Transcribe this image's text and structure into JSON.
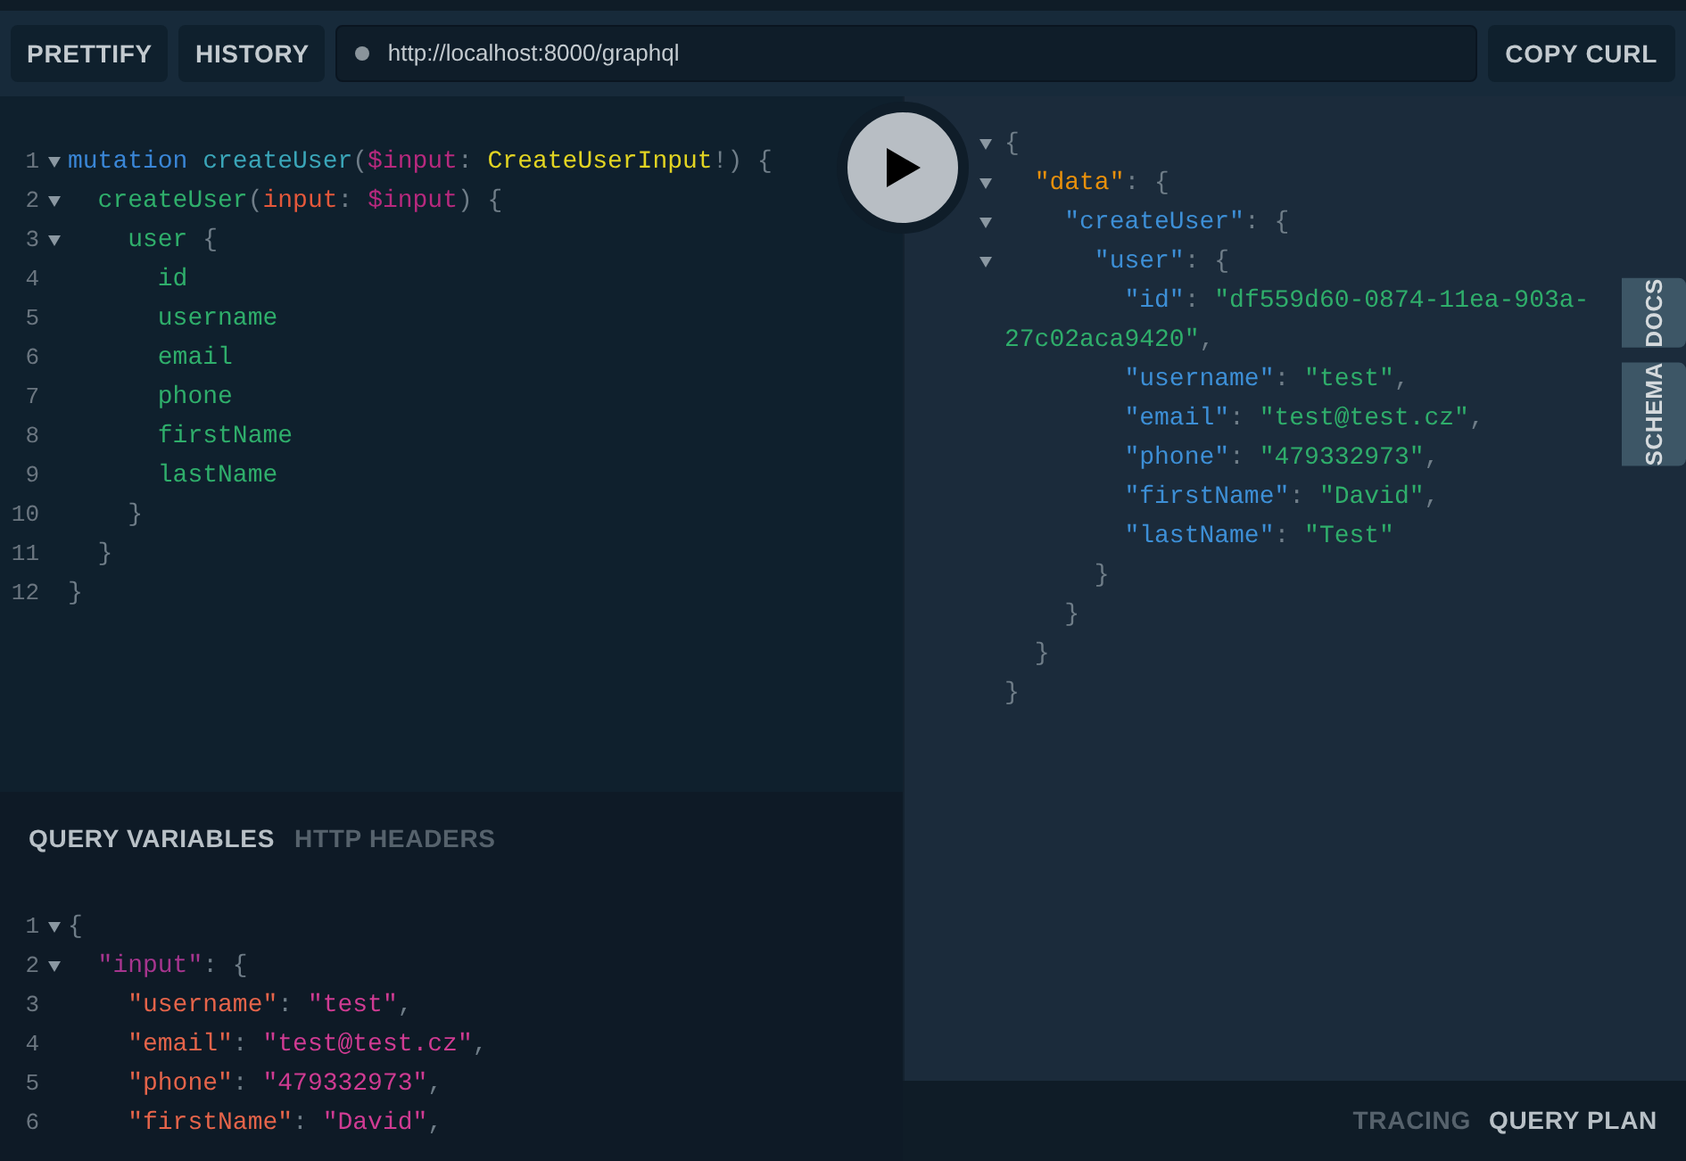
{
  "toolbar": {
    "buttons": [
      "PRETTIFY",
      "HISTORY"
    ],
    "url": "http://localhost:8000/graphql",
    "copy_button": "COPY CURL"
  },
  "query_editor": {
    "lines": [
      {
        "number": "1",
        "foldable": true,
        "tokens": [
          {
            "kind": "keyword",
            "text": "mutation "
          },
          {
            "kind": "def",
            "text": "createUser"
          },
          {
            "kind": "punct",
            "text": "("
          },
          {
            "kind": "variable",
            "text": "$input"
          },
          {
            "kind": "punct",
            "text": ": "
          },
          {
            "kind": "type",
            "text": "CreateUserInput"
          },
          {
            "kind": "punct",
            "text": "!) {"
          }
        ]
      },
      {
        "number": "2",
        "foldable": true,
        "tokens": [
          {
            "kind": "field",
            "text": "  createUser"
          },
          {
            "kind": "punct",
            "text": "("
          },
          {
            "kind": "argument",
            "text": "input"
          },
          {
            "kind": "punct",
            "text": ": "
          },
          {
            "kind": "variable",
            "text": "$input"
          },
          {
            "kind": "punct",
            "text": ") {"
          }
        ]
      },
      {
        "number": "3",
        "foldable": true,
        "tokens": [
          {
            "kind": "field",
            "text": "    user "
          },
          {
            "kind": "punct",
            "text": "{"
          }
        ]
      },
      {
        "number": "4",
        "foldable": false,
        "tokens": [
          {
            "kind": "field",
            "text": "      id"
          }
        ]
      },
      {
        "number": "5",
        "foldable": false,
        "tokens": [
          {
            "kind": "field",
            "text": "      username"
          }
        ]
      },
      {
        "number": "6",
        "foldable": false,
        "tokens": [
          {
            "kind": "field",
            "text": "      email"
          }
        ]
      },
      {
        "number": "7",
        "foldable": false,
        "tokens": [
          {
            "kind": "field",
            "text": "      phone"
          }
        ]
      },
      {
        "number": "8",
        "foldable": false,
        "tokens": [
          {
            "kind": "field",
            "text": "      firstName"
          }
        ]
      },
      {
        "number": "9",
        "foldable": false,
        "tokens": [
          {
            "kind": "field",
            "text": "      lastName"
          }
        ]
      },
      {
        "number": "10",
        "foldable": false,
        "tokens": [
          {
            "kind": "punct",
            "text": "    }"
          }
        ]
      },
      {
        "number": "11",
        "foldable": false,
        "tokens": [
          {
            "kind": "punct",
            "text": "  }"
          }
        ]
      },
      {
        "number": "12",
        "foldable": false,
        "tokens": [
          {
            "kind": "punct",
            "text": "}"
          }
        ]
      }
    ]
  },
  "variables_panel": {
    "tabs": [
      {
        "label": "QUERY VARIABLES",
        "selected": true
      },
      {
        "label": "HTTP HEADERS",
        "selected": false
      }
    ],
    "lines": [
      {
        "number": "1",
        "foldable": true,
        "tokens": [
          {
            "kind": "punct",
            "text": "{"
          }
        ]
      },
      {
        "number": "2",
        "foldable": true,
        "tokens": [
          {
            "kind": "var-root",
            "text": "  \"input\""
          },
          {
            "kind": "punct",
            "text": ": {"
          }
        ]
      },
      {
        "number": "3",
        "foldable": false,
        "tokens": [
          {
            "kind": "var-key",
            "text": "    \"username\""
          },
          {
            "kind": "punct",
            "text": ": "
          },
          {
            "kind": "var-string",
            "text": "\"test\""
          },
          {
            "kind": "punct",
            "text": ","
          }
        ]
      },
      {
        "number": "4",
        "foldable": false,
        "tokens": [
          {
            "kind": "var-key",
            "text": "    \"email\""
          },
          {
            "kind": "punct",
            "text": ": "
          },
          {
            "kind": "var-string",
            "text": "\"test@test.cz\""
          },
          {
            "kind": "punct",
            "text": ","
          }
        ]
      },
      {
        "number": "5",
        "foldable": false,
        "tokens": [
          {
            "kind": "var-key",
            "text": "    \"phone\""
          },
          {
            "kind": "punct",
            "text": ": "
          },
          {
            "kind": "var-string",
            "text": "\"479332973\""
          },
          {
            "kind": "punct",
            "text": ","
          }
        ]
      },
      {
        "number": "6",
        "foldable": false,
        "tokens": [
          {
            "kind": "var-key",
            "text": "    \"firstName\""
          },
          {
            "kind": "punct",
            "text": ": "
          },
          {
            "kind": "var-string",
            "text": "\"David\""
          },
          {
            "kind": "punct",
            "text": ","
          }
        ]
      }
    ]
  },
  "result": {
    "lines": [
      {
        "foldable": true,
        "tokens": [
          {
            "kind": "punct",
            "text": "{"
          }
        ]
      },
      {
        "foldable": true,
        "tokens": [
          {
            "kind": "data-key",
            "text": "  \"data\""
          },
          {
            "kind": "punct",
            "text": ": {"
          }
        ]
      },
      {
        "foldable": true,
        "tokens": [
          {
            "kind": "key",
            "text": "    \"createUser\""
          },
          {
            "kind": "punct",
            "text": ": {"
          }
        ]
      },
      {
        "foldable": true,
        "tokens": [
          {
            "kind": "key",
            "text": "      \"user\""
          },
          {
            "kind": "punct",
            "text": ": {"
          }
        ]
      },
      {
        "foldable": false,
        "tokens": [
          {
            "kind": "key",
            "text": "        \"id\""
          },
          {
            "kind": "punct",
            "text": ": "
          },
          {
            "kind": "string",
            "text": "\"df559d60-0874-11ea-903a-27c02aca9420\""
          },
          {
            "kind": "punct",
            "text": ","
          }
        ]
      },
      {
        "foldable": false,
        "tokens": [
          {
            "kind": "key",
            "text": "        \"username\""
          },
          {
            "kind": "punct",
            "text": ": "
          },
          {
            "kind": "string",
            "text": "\"test\""
          },
          {
            "kind": "punct",
            "text": ","
          }
        ]
      },
      {
        "foldable": false,
        "tokens": [
          {
            "kind": "key",
            "text": "        \"email\""
          },
          {
            "kind": "punct",
            "text": ": "
          },
          {
            "kind": "string",
            "text": "\"test@test.cz\""
          },
          {
            "kind": "punct",
            "text": ","
          }
        ]
      },
      {
        "foldable": false,
        "tokens": [
          {
            "kind": "key",
            "text": "        \"phone\""
          },
          {
            "kind": "punct",
            "text": ": "
          },
          {
            "kind": "string",
            "text": "\"479332973\""
          },
          {
            "kind": "punct",
            "text": ","
          }
        ]
      },
      {
        "foldable": false,
        "tokens": [
          {
            "kind": "key",
            "text": "        \"firstName\""
          },
          {
            "kind": "punct",
            "text": ": "
          },
          {
            "kind": "string",
            "text": "\"David\""
          },
          {
            "kind": "punct",
            "text": ","
          }
        ]
      },
      {
        "foldable": false,
        "tokens": [
          {
            "kind": "key",
            "text": "        \"lastName\""
          },
          {
            "kind": "punct",
            "text": ": "
          },
          {
            "kind": "string",
            "text": "\"Test\""
          }
        ]
      },
      {
        "foldable": false,
        "tokens": [
          {
            "kind": "punct",
            "text": "      }"
          }
        ]
      },
      {
        "foldable": false,
        "tokens": [
          {
            "kind": "punct",
            "text": "    }"
          }
        ]
      },
      {
        "foldable": false,
        "tokens": [
          {
            "kind": "punct",
            "text": "  }"
          }
        ]
      },
      {
        "foldable": false,
        "tokens": [
          {
            "kind": "punct",
            "text": "}"
          }
        ]
      }
    ]
  },
  "side_tabs": [
    "DOCS",
    "SCHEMA"
  ],
  "footer_tabs": [
    {
      "label": "TRACING",
      "selected": false
    },
    {
      "label": "QUERY PLAN",
      "selected": true
    }
  ]
}
